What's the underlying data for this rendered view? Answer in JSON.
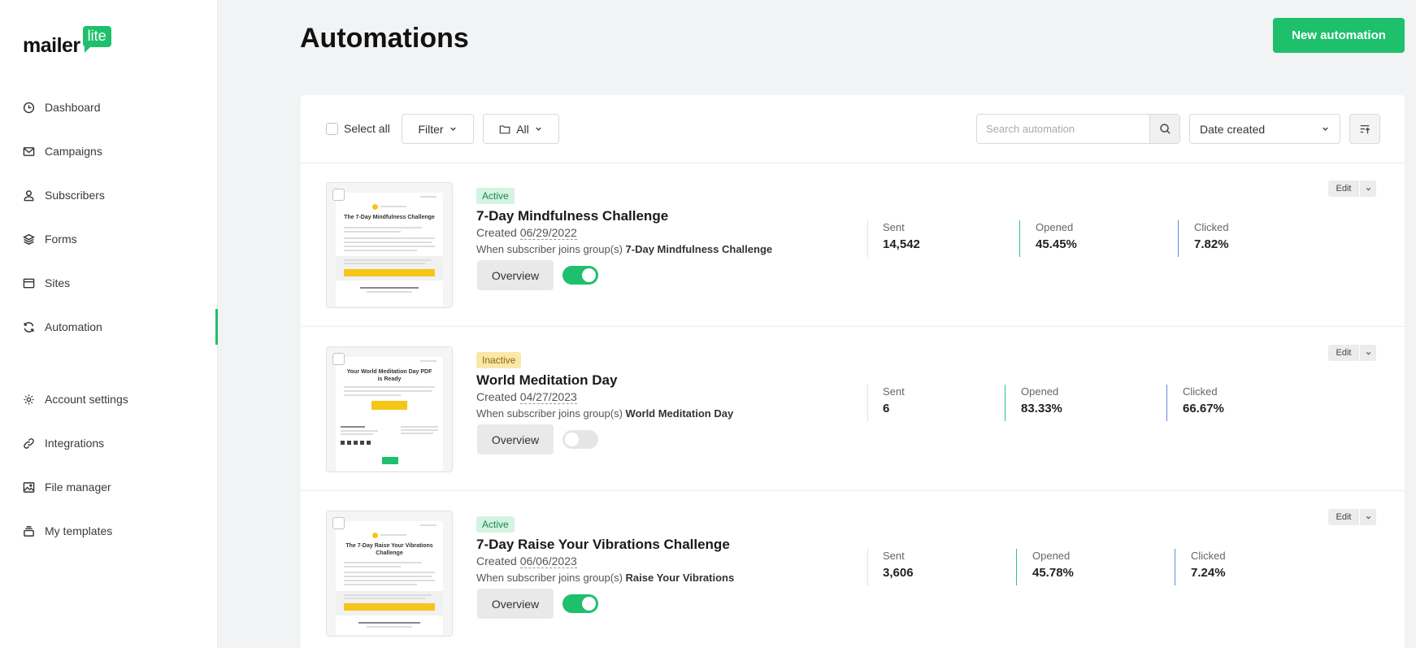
{
  "brand": {
    "word": "mailer",
    "badge": "lite",
    "color": "#1ec06b"
  },
  "sidebar": {
    "items": [
      {
        "label": "Dashboard",
        "icon": "clock-icon"
      },
      {
        "label": "Campaigns",
        "icon": "envelope-icon"
      },
      {
        "label": "Subscribers",
        "icon": "person-icon"
      },
      {
        "label": "Forms",
        "icon": "layers-icon"
      },
      {
        "label": "Sites",
        "icon": "browser-icon"
      },
      {
        "label": "Automation",
        "icon": "refresh-icon",
        "active": true
      },
      {
        "label": "Account settings",
        "icon": "gear-icon"
      },
      {
        "label": "Integrations",
        "icon": "link-icon"
      },
      {
        "label": "File manager",
        "icon": "image-icon"
      },
      {
        "label": "My templates",
        "icon": "stack-icon"
      }
    ]
  },
  "header": {
    "title": "Automations",
    "new_button": "New automation"
  },
  "toolbar": {
    "select_all": "Select all",
    "filter": "Filter",
    "folder": "All",
    "search_placeholder": "Search automation",
    "sort": "Date created"
  },
  "automations": [
    {
      "status": "Active",
      "title": "7-Day Mindfulness Challenge",
      "created_label": "Created",
      "created_date": "06/29/2022",
      "trigger_prefix": "When subscriber joins group(s)",
      "trigger_group": "7-Day Mindfulness Challenge",
      "overview": "Overview",
      "enabled": true,
      "edit": "Edit",
      "stats": {
        "sent_label": "Sent",
        "sent": "14,542",
        "opened_label": "Opened",
        "opened": "45.45%",
        "clicked_label": "Clicked",
        "clicked": "7.82%"
      },
      "thumb": {
        "title": "The 7-Day Mindfulness Challenge",
        "button": "Get the 7-Day Mindfulness Journal",
        "footer": "7-Day Mindfulness Journal"
      }
    },
    {
      "status": "Inactive",
      "title": "World Meditation Day",
      "created_label": "Created",
      "created_date": "04/27/2023",
      "trigger_prefix": "When subscriber joins group(s)",
      "trigger_group": "World Meditation Day",
      "overview": "Overview",
      "enabled": false,
      "edit": "Edit",
      "stats": {
        "sent_label": "Sent",
        "sent": "6",
        "opened_label": "Opened",
        "opened": "83.33%",
        "clicked_label": "Clicked",
        "clicked": "66.67%"
      },
      "thumb": {
        "title": "Your World Meditation Day PDF is Ready",
        "button": "Download PDF",
        "footer": "Mindfulness Box"
      }
    },
    {
      "status": "Active",
      "title": "7-Day Raise Your Vibrations Challenge",
      "created_label": "Created",
      "created_date": "06/06/2023",
      "trigger_prefix": "When subscriber joins group(s)",
      "trigger_group": "Raise Your Vibrations",
      "overview": "Overview",
      "enabled": true,
      "edit": "Edit",
      "stats": {
        "sent_label": "Sent",
        "sent": "3,606",
        "opened_label": "Opened",
        "opened": "45.78%",
        "clicked_label": "Clicked",
        "clicked": "7.24%"
      },
      "thumb": {
        "title": "The 7-Day Raise Your Vibrations Challenge",
        "button": "Get the 7-Day Raise Your Vibrations Journal",
        "footer": "7-Day Raise Your Vibrations Journal"
      }
    }
  ],
  "colors": {
    "accent": "#1ec06b",
    "opened_divider": "#2fbf8a",
    "clicked_divider": "#5b8dd9"
  }
}
